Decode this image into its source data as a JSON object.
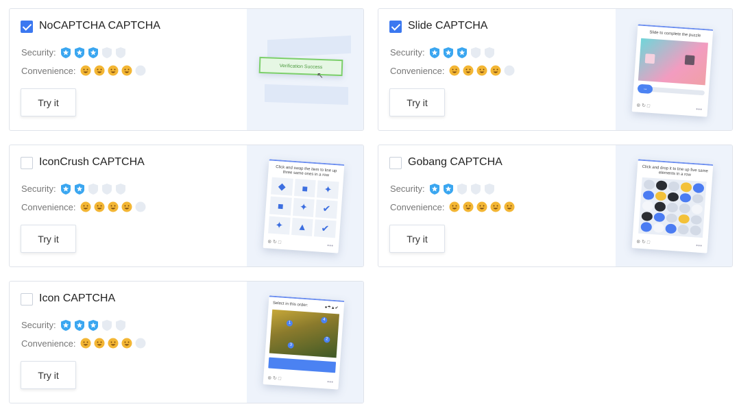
{
  "labels": {
    "security": "Security:",
    "convenience": "Convenience:",
    "try": "Try it"
  },
  "colors": {
    "accent": "#3b78f0",
    "shield_on": "#3aa6f0",
    "shield_off": "#e6ebf2",
    "face_on": "#f3b634",
    "face_off": "#e6ebf2"
  },
  "cards": [
    {
      "title": "NoCAPTCHA CAPTCHA",
      "checked": true,
      "security": 3,
      "convenience": 4,
      "preview_text": "Verification Success"
    },
    {
      "title": "Slide CAPTCHA",
      "checked": true,
      "security": 3,
      "convenience": 4,
      "preview_text": "Slide to complete the puzzle"
    },
    {
      "title": "IconCrush CAPTCHA",
      "checked": false,
      "security": 2,
      "convenience": 4,
      "preview_text": "Click and swap the item to line up three same ones in a row"
    },
    {
      "title": "Gobang CAPTCHA",
      "checked": false,
      "security": 2,
      "convenience": 5,
      "preview_text": "Click and drop it to line up five same elements in a row"
    },
    {
      "title": "Icon CAPTCHA",
      "checked": false,
      "security": 3,
      "convenience": 4,
      "preview_text": "Select in this order:"
    }
  ]
}
